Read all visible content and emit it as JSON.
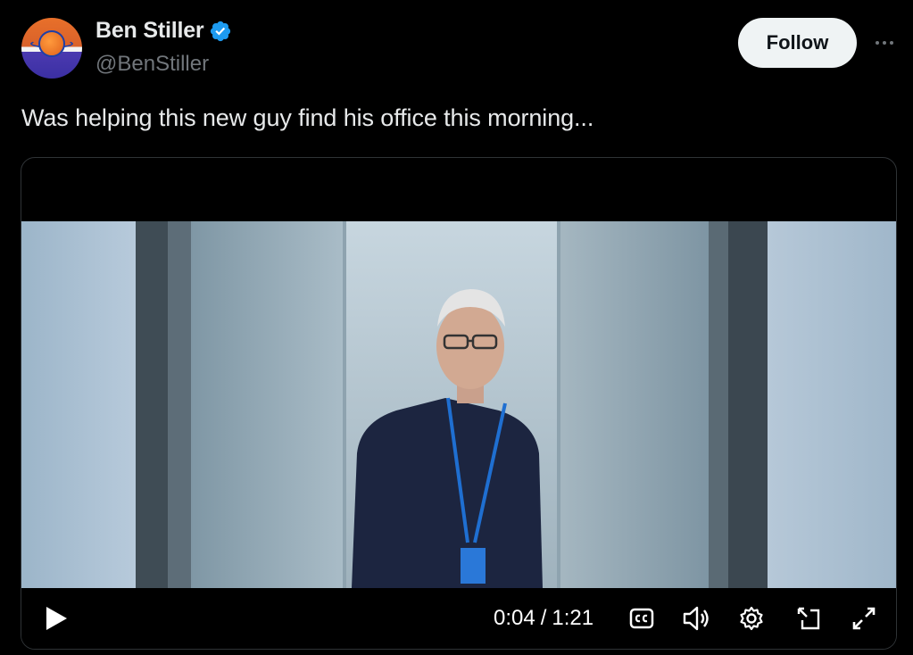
{
  "author": {
    "display_name": "Ben Stiller",
    "handle": "@BenStiller",
    "verified": true,
    "avatar_icon": "knicks-logo-avatar"
  },
  "actions": {
    "follow_label": "Follow",
    "more_icon": "more-horizontal-icon"
  },
  "tweet": {
    "text": "Was helping this new guy find his office this morning..."
  },
  "video": {
    "current_time": "0:04",
    "separator": "/",
    "duration": "1:21",
    "progress_fraction": 0.055,
    "controls": {
      "play_icon": "play-icon",
      "cc_icon": "closed-captions-icon",
      "volume_icon": "volume-icon",
      "settings_icon": "gear-icon",
      "pip_icon": "picture-in-picture-icon",
      "fullscreen_icon": "fullscreen-icon"
    }
  },
  "colors": {
    "background": "#000000",
    "text_primary": "#e7e9ea",
    "text_secondary": "#71767b",
    "verified_blue": "#1d9bf0",
    "follow_bg": "#eff3f4"
  }
}
